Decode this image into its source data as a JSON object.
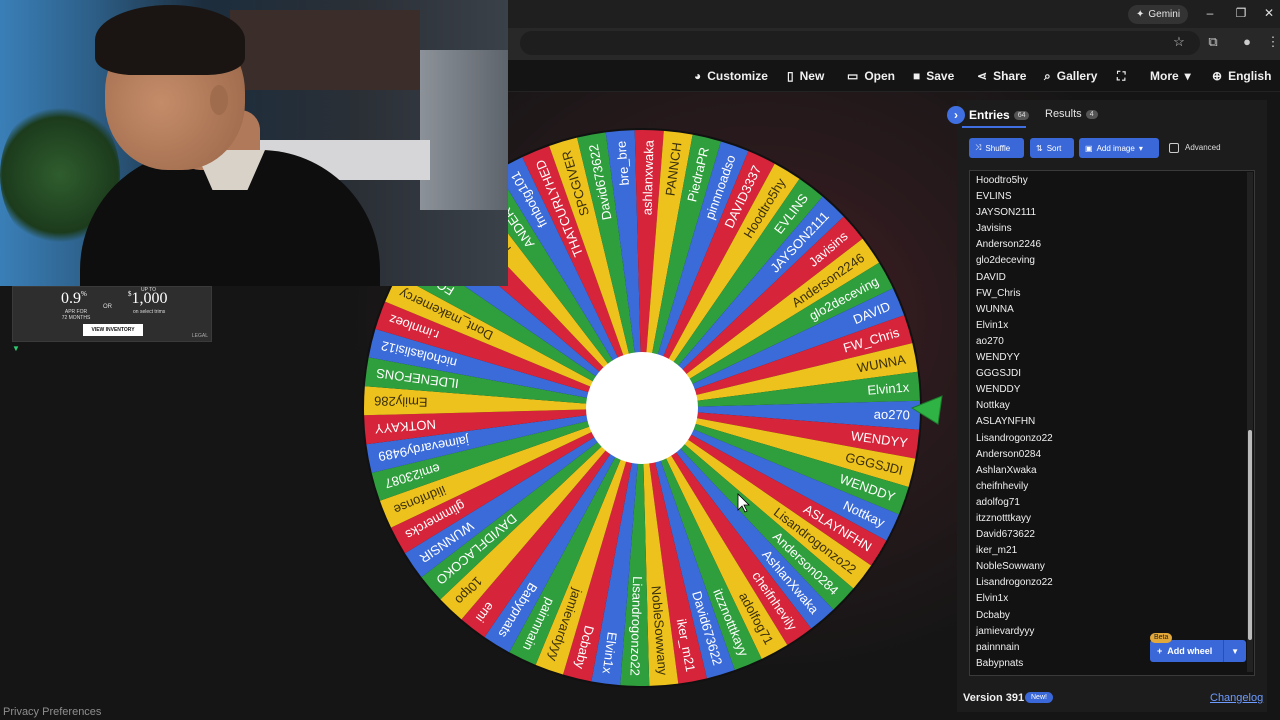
{
  "browser": {
    "gemini_label": "Gemini",
    "window_controls": [
      "–",
      "❐",
      "✕"
    ]
  },
  "toolbar": {
    "customize": "Customize",
    "new": "New",
    "open": "Open",
    "save": "Save",
    "share": "Share",
    "gallery": "Gallery",
    "more": "More",
    "language": "English"
  },
  "ad": {
    "apr": "0.9",
    "apr_unit": "%",
    "apr_sub1": "APR FOR",
    "apr_sub2": "72 MONTHS",
    "or": "OR",
    "up_to": "UP TO",
    "currency": "$",
    "amount": "1,000",
    "amount_sub": "on select trims",
    "button": "VIEW INVENTORY",
    "legal": "LEGAL"
  },
  "wheel": {
    "colors": [
      "#3b6bd8",
      "#d6243a",
      "#edc21d",
      "#2f9e3c"
    ],
    "segments": [
      "ao270",
      "WENDYY",
      "GGGSJDI",
      "WENDDY",
      "Nottkay",
      "ASLAYNFHN",
      "Lisandrogonzo22",
      "Anderson0284",
      "AshlanXwaka",
      "cheifnhevily",
      "adolfog71",
      "itzznotttkayy",
      "David673622",
      "iker_m21",
      "NobleSowwany",
      "Lisandrogonzo22",
      "Elvin1x",
      "Dcbaby",
      "jamievardyyy",
      "painnnain",
      "Babypnats",
      "emi",
      "10tpo",
      "DAVIDFLACOKO",
      "WUNNSIR",
      "glimmercks",
      "ilidnfonse",
      "emi23087",
      "jaimevardy9489",
      "NOTKAYY",
      "Emily286",
      "ILDENEFONS",
      "nicholaslisi12",
      "r.imnloez",
      "Dont_makemercy",
      "FONSO",
      "GUNNNA",
      "BREBER",
      "fw_chris90",
      "ANDERSPN",
      "fmbotg101",
      "THATCURLYHED",
      "SPCGIVER",
      "David673622",
      "bre_bre",
      "ashlanxwaka",
      "PANNCH",
      "PiedraPR",
      "pinnnoadso",
      "DAVID3337",
      "Hoodtro5hy",
      "EVLINS",
      "JAYSON2111",
      "Javisins",
      "Anderson2246",
      "glo2deceving",
      "DAVID",
      "FW_Chris",
      "WUNNA",
      "Elvin1x"
    ]
  },
  "panel": {
    "entries_tab": "Entries",
    "entries_count": "64",
    "results_tab": "Results",
    "results_count": "4",
    "shuffle": "Shuffle",
    "sort": "Sort",
    "add_image": "Add image",
    "advanced": "Advanced",
    "entries": [
      "Hoodtro5hy",
      "EVLINS",
      "JAYSON2111",
      "Javisins",
      "Anderson2246",
      "glo2deceving",
      "DAVID",
      "FW_Chris",
      "WUNNA",
      "Elvin1x",
      "ao270",
      "WENDYY",
      "GGGSJDI",
      "WENDDY",
      "Nottkay",
      "ASLAYNFHN",
      "Lisandrogonzo22",
      "Anderson0284",
      "AshlanXwaka",
      "cheifnhevily",
      "adolfog71",
      "itzznotttkayy",
      "David673622",
      "iker_m21",
      "NobleSowwany",
      "Lisandrogonzo22",
      "Elvin1x",
      "Dcbaby",
      "jamievardyyy",
      "painnnain",
      "Babypnats"
    ],
    "beta": "Beta",
    "add_wheel": "Add wheel",
    "version": "Version 391",
    "new_badge": "New!",
    "changelog": "Changelog"
  },
  "footer": {
    "privacy": "Privacy Preferences"
  }
}
